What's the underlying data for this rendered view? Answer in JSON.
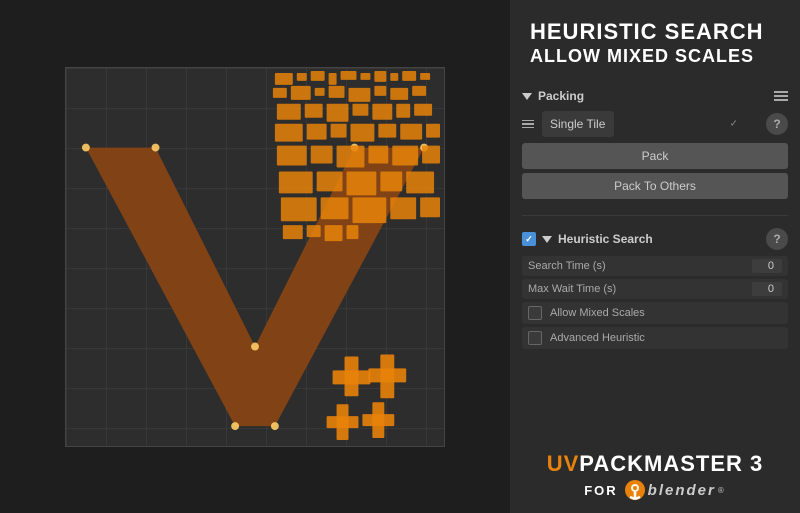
{
  "header": {
    "title_line1": "HEURISTIC SEARCH",
    "title_line2": "ALLOW MIXED SCALES"
  },
  "packing": {
    "section_label": "Packing",
    "dropdown_value": "Single Tile",
    "pack_button": "Pack",
    "pack_to_others_button": "Pack To Others"
  },
  "heuristic": {
    "section_label": "Heuristic Search",
    "enabled": true,
    "search_time_label": "Search Time (s)",
    "search_time_value": "0",
    "max_wait_label": "Max Wait Time (s)",
    "max_wait_value": "0",
    "allow_mixed_label": "Allow Mixed Scales",
    "advanced_label": "Advanced Heuristic"
  },
  "branding": {
    "uv": "UV",
    "packmaster": "PACKMASTER",
    "version": "3",
    "for_text": "FOR",
    "blender_text": "blender",
    "trademark": "®"
  },
  "icons": {
    "triangle_down": "▼",
    "checkmark": "✓",
    "help": "?",
    "menu": "≡"
  }
}
